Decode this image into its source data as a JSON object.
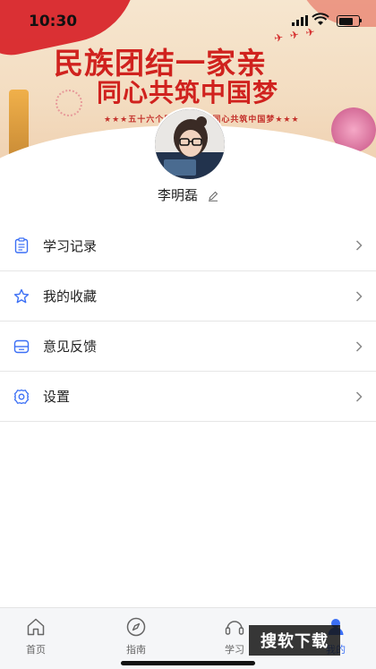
{
  "status_bar": {
    "time": "10:30"
  },
  "banner": {
    "title_line1": "民族团结一家亲",
    "title_line2": "同心共筑中国梦",
    "subtitle": "★★★五十六个民族一家亲 同心共筑中国梦★★★"
  },
  "profile": {
    "username": "李明磊"
  },
  "menu": {
    "items": [
      {
        "label": "学习记录",
        "icon": "clipboard-icon"
      },
      {
        "label": "我的收藏",
        "icon": "star-icon"
      },
      {
        "label": "意见反馈",
        "icon": "feedback-icon"
      },
      {
        "label": "设置",
        "icon": "gear-icon"
      }
    ]
  },
  "tabbar": {
    "tabs": [
      {
        "label": "首页",
        "icon": "home-icon"
      },
      {
        "label": "指南",
        "icon": "compass-icon"
      },
      {
        "label": "学习",
        "icon": "headset-icon"
      },
      {
        "label": "我的",
        "icon": "user-icon"
      }
    ],
    "active_color": "#3b6ff5"
  },
  "watermark": "搜软下载",
  "colors": {
    "accent": "#3b6ff5",
    "banner_red": "#d0221e"
  }
}
